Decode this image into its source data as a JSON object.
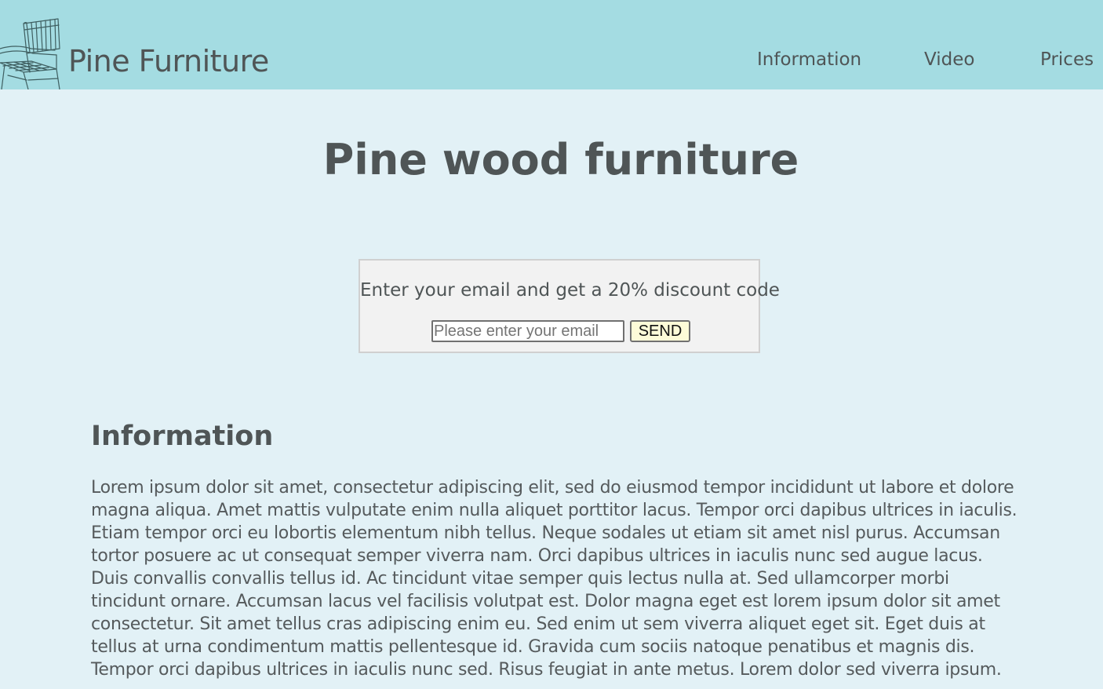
{
  "header": {
    "logo_icon": "chair-icon",
    "brand": "Pine Furniture",
    "nav": [
      {
        "label": "Information"
      },
      {
        "label": "Video"
      },
      {
        "label": "Prices"
      }
    ]
  },
  "main": {
    "title": "Pine wood furniture",
    "discount": {
      "text": "Enter your email and get a 20% discount code",
      "email_placeholder": "Please enter your email",
      "email_value": "",
      "send_label": "SEND"
    },
    "info": {
      "heading": "Information",
      "body": "Lorem ipsum dolor sit amet, consectetur adipiscing elit, sed do eiusmod tempor incididunt ut labore et dolore magna aliqua. Amet mattis vulputate enim nulla aliquet porttitor lacus. Tempor orci dapibus ultrices in iaculis. Etiam tempor orci eu lobortis elementum nibh tellus. Neque sodales ut etiam sit amet nisl purus. Accumsan tortor posuere ac ut consequat semper viverra nam. Orci dapibus ultrices in iaculis nunc sed augue lacus. Duis convallis convallis tellus id. Ac tincidunt vitae semper quis lectus nulla at. Sed ullamcorper morbi tincidunt ornare. Accumsan lacus vel facilisis volutpat est. Dolor magna eget est lorem ipsum dolor sit amet consectetur. Sit amet tellus cras adipiscing enim eu. Sed enim ut sem viverra aliquet eget sit. Eget duis at tellus at urna condimentum mattis pellentesque id. Gravida cum sociis natoque penatibus et magnis dis. Tempor orci dapibus ultrices in iaculis nunc sed. Risus feugiat in ante metus. Lorem dolor sed viverra ipsum."
    }
  },
  "colors": {
    "header_bg": "#a4dce2",
    "page_bg": "#e2f1f6",
    "text": "#4f5556",
    "box_bg": "#f2f2f2",
    "button_bg": "#fdfbd8"
  }
}
